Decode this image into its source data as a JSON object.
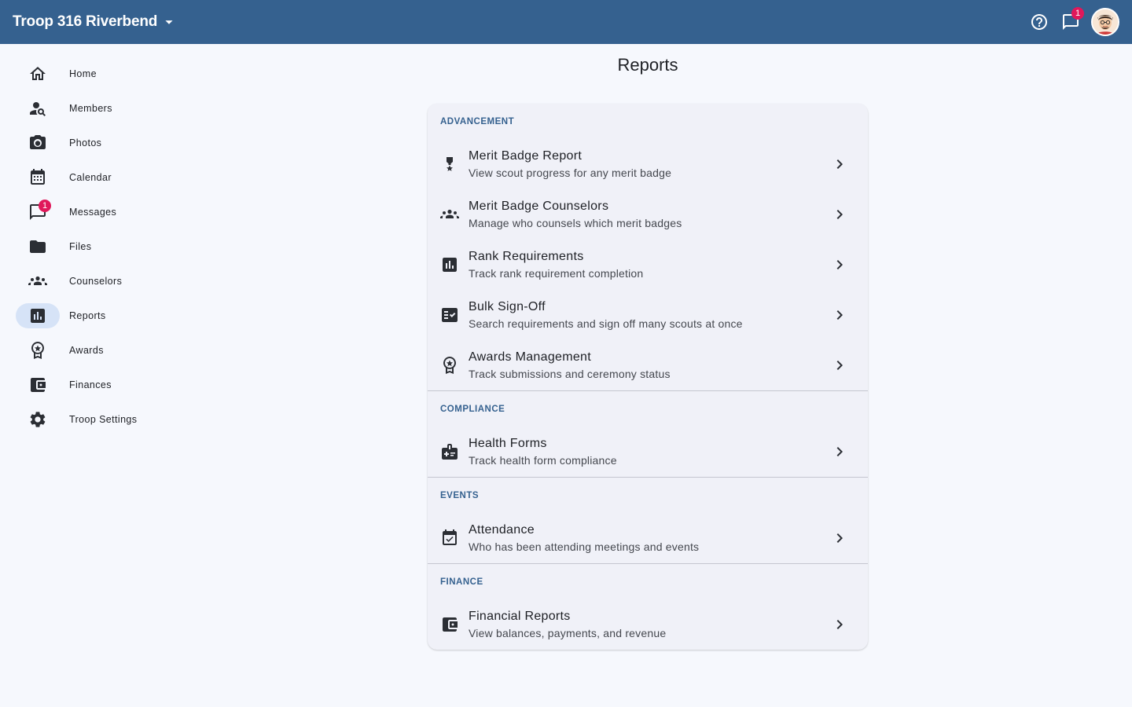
{
  "topbar": {
    "troop_name": "Troop 316 Riverbend",
    "messages_badge": "1"
  },
  "sidebar": {
    "items": [
      {
        "label": "Home",
        "icon": "home-icon"
      },
      {
        "label": "Members",
        "icon": "person-search-icon"
      },
      {
        "label": "Photos",
        "icon": "camera-icon"
      },
      {
        "label": "Calendar",
        "icon": "calendar-icon"
      },
      {
        "label": "Messages",
        "icon": "chat-icon",
        "badge": "1"
      },
      {
        "label": "Files",
        "icon": "folder-icon"
      },
      {
        "label": "Counselors",
        "icon": "groups-icon"
      },
      {
        "label": "Reports",
        "icon": "bar-chart-icon",
        "active": true
      },
      {
        "label": "Awards",
        "icon": "award-icon"
      },
      {
        "label": "Finances",
        "icon": "wallet-icon"
      },
      {
        "label": "Troop Settings",
        "icon": "gear-icon"
      }
    ]
  },
  "page": {
    "title": "Reports"
  },
  "sections": [
    {
      "header": "ADVANCEMENT",
      "rows": [
        {
          "title": "Merit Badge Report",
          "subtitle": "View scout progress for any merit badge",
          "icon": "medal-icon"
        },
        {
          "title": "Merit Badge Counselors",
          "subtitle": "Manage who counsels which merit badges",
          "icon": "groups-icon"
        },
        {
          "title": "Rank Requirements",
          "subtitle": "Track rank requirement completion",
          "icon": "bar-chart-icon"
        },
        {
          "title": "Bulk Sign-Off",
          "subtitle": "Search requirements and sign off many scouts at once",
          "icon": "checklist-icon"
        },
        {
          "title": "Awards Management",
          "subtitle": "Track submissions and ceremony status",
          "icon": "award-icon"
        }
      ]
    },
    {
      "header": "COMPLIANCE",
      "rows": [
        {
          "title": "Health Forms",
          "subtitle": "Track health form compliance",
          "icon": "medical-badge-icon"
        }
      ]
    },
    {
      "header": "EVENTS",
      "rows": [
        {
          "title": "Attendance",
          "subtitle": "Who has been attending meetings and events",
          "icon": "event-available-icon"
        }
      ]
    },
    {
      "header": "FINANCE",
      "rows": [
        {
          "title": "Financial Reports",
          "subtitle": "View balances, payments, and revenue",
          "icon": "wallet-icon"
        }
      ]
    }
  ],
  "colors": {
    "topbar": "#35618f",
    "background": "#f6f8fd",
    "card": "#f0f1f8",
    "active_pill": "#d6e3f7",
    "badge": "#e0185a",
    "section_header": "#35618f"
  }
}
